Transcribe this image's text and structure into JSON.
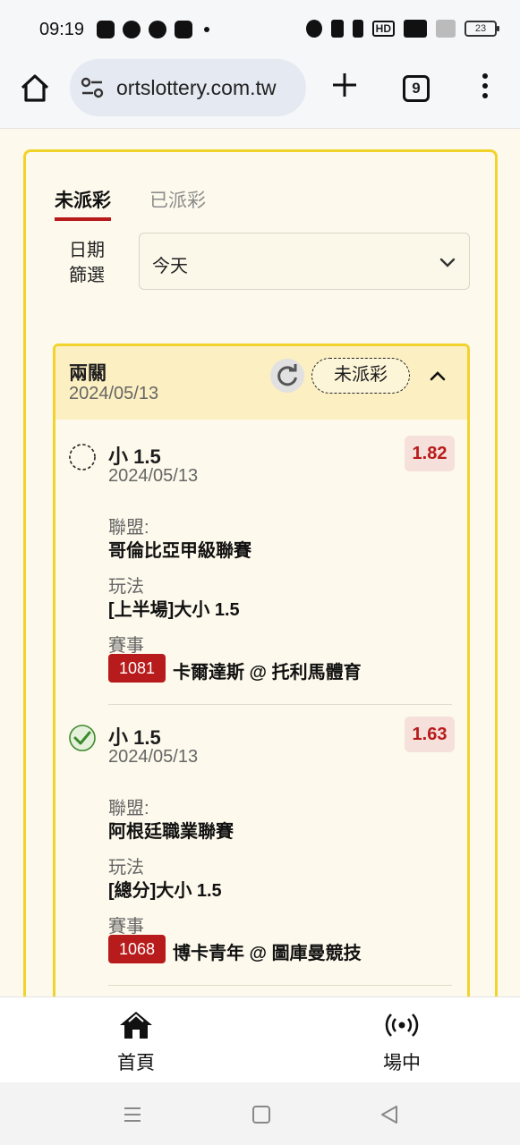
{
  "status_bar": {
    "time": "09:19",
    "battery": "23",
    "hd_label": "HD"
  },
  "browser": {
    "url": "ortslottery.com.tw",
    "tab_count": "9"
  },
  "tabs": [
    {
      "label": "未派彩",
      "active": true
    },
    {
      "label": "已派彩",
      "active": false
    }
  ],
  "filter": {
    "label": "日期\n篩選",
    "label_line1": "日期",
    "label_line2": "篩選",
    "value": "今天"
  },
  "bet_card": {
    "type": "兩關",
    "date": "2024/05/13",
    "status": "未派彩",
    "items": [
      {
        "selection": "小 1.5",
        "date": "2024/05/13",
        "odds": "1.82",
        "checked": false,
        "league_label": "聯盟:",
        "league": "哥倫比亞甲級聯賽",
        "play_label": "玩法",
        "play": "[上半場]大小 1.5",
        "match_label": "賽事",
        "match_no": "1081",
        "match": "卡爾達斯 @ 托利馬體育"
      },
      {
        "selection": "小 1.5",
        "date": "2024/05/13",
        "odds": "1.63",
        "checked": true,
        "league_label": "聯盟:",
        "league": "阿根廷職業聯賽",
        "play_label": "玩法",
        "play": "[總分]大小 1.5",
        "match_label": "賽事",
        "match_no": "1068",
        "match": "博卡青年 @ 圖庫曼競技"
      }
    ]
  },
  "bottom_nav": [
    {
      "label": "首頁",
      "icon": "home-icon"
    },
    {
      "label": "場中",
      "icon": "live-broadcast-icon"
    }
  ],
  "colors": {
    "accent_red": "#b81b1b",
    "card_border": "#f2d32c",
    "card_head": "#fcefc1",
    "check_green": "#3d8a2e"
  }
}
